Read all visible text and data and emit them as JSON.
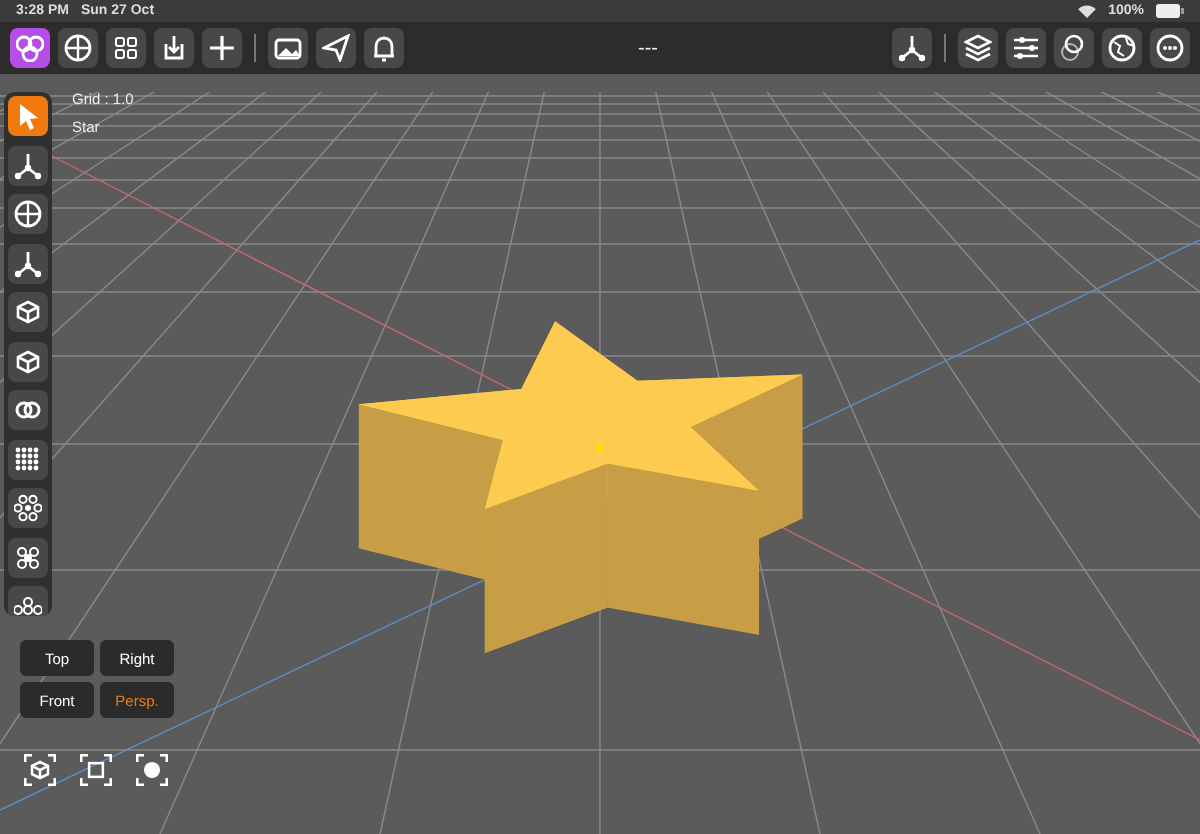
{
  "status_bar": {
    "time": "3:28 PM",
    "date": "Sun 27 Oct",
    "battery": "100%"
  },
  "toolbar": {
    "left": [
      {
        "kind": "app",
        "selected": true
      },
      {
        "kind": "shapes",
        "selected": false
      },
      {
        "kind": "grid",
        "selected": false
      },
      {
        "kind": "import",
        "selected": false
      },
      {
        "kind": "add",
        "selected": false
      }
    ],
    "middle": [
      {
        "kind": "photo",
        "selected": false
      },
      {
        "kind": "send",
        "selected": false
      },
      {
        "kind": "bell",
        "selected": false
      }
    ],
    "title": "---",
    "right": [
      {
        "kind": "axes"
      },
      {
        "kind": "layers"
      },
      {
        "kind": "sliders"
      },
      {
        "kind": "material"
      },
      {
        "kind": "globe"
      },
      {
        "kind": "more"
      }
    ]
  },
  "viewport": {
    "grid_label": "Grid : 1.0",
    "object_name": "Star"
  },
  "tools": [
    {
      "kind": "select",
      "selected": true
    },
    {
      "kind": "move",
      "selected": false
    },
    {
      "kind": "sphere",
      "selected": false
    },
    {
      "kind": "vertex",
      "selected": false
    },
    {
      "kind": "cube",
      "selected": false
    },
    {
      "kind": "cube-rotate",
      "selected": false
    },
    {
      "kind": "link",
      "selected": false
    },
    {
      "kind": "array",
      "selected": false
    },
    {
      "kind": "ring",
      "selected": false
    },
    {
      "kind": "cluster",
      "selected": false
    },
    {
      "kind": "chain",
      "selected": false
    }
  ],
  "views": [
    {
      "label": "Top",
      "selected": false
    },
    {
      "label": "Right",
      "selected": false
    },
    {
      "label": "Front",
      "selected": false
    },
    {
      "label": "Persp.",
      "selected": true
    }
  ],
  "camera_buttons": [
    {
      "kind": "focus-cube"
    },
    {
      "kind": "frame-cube"
    },
    {
      "kind": "focus-object"
    }
  ]
}
